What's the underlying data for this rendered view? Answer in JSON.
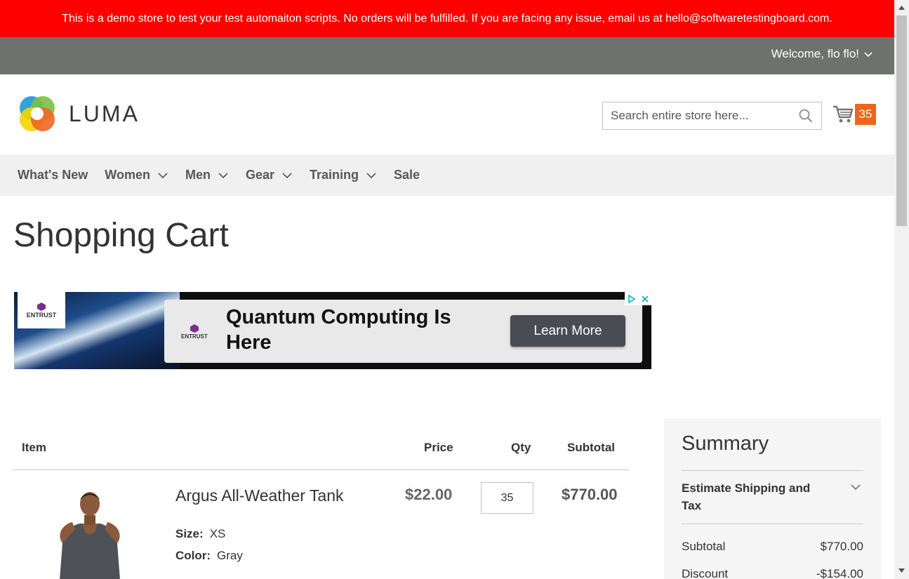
{
  "notice": {
    "text": "This is a demo store to test your test automaiton scripts. No orders will be fulfilled. If you are facing any issue, email us at hello@softwaretestingboard.com.",
    "bg": "#ff0000"
  },
  "header_panel": {
    "welcome": "Welcome, flo flo!"
  },
  "logo": {
    "text": "LUMA"
  },
  "search": {
    "placeholder": "Search entire store here..."
  },
  "minicart": {
    "count": "35",
    "badge_color": "#f1641c"
  },
  "nav": {
    "items": [
      {
        "label": "What's New",
        "has_dropdown": false
      },
      {
        "label": "Women",
        "has_dropdown": true
      },
      {
        "label": "Men",
        "has_dropdown": true
      },
      {
        "label": "Gear",
        "has_dropdown": true
      },
      {
        "label": "Training",
        "has_dropdown": true
      },
      {
        "label": "Sale",
        "has_dropdown": false
      }
    ]
  },
  "page": {
    "title": "Shopping Cart"
  },
  "ad": {
    "brand": "ENTRUST",
    "headline": "Quantum Computing Is Here",
    "cta": "Learn More"
  },
  "cart": {
    "columns": {
      "item": "Item",
      "price": "Price",
      "qty": "Qty",
      "subtotal": "Subtotal"
    },
    "items": [
      {
        "name": "Argus All-Weather Tank",
        "price": "$22.00",
        "qty": "35",
        "subtotal": "$770.00",
        "options": [
          {
            "label": "Size:",
            "value": "XS"
          },
          {
            "label": "Color:",
            "value": "Gray"
          }
        ]
      }
    ]
  },
  "summary": {
    "title": "Summary",
    "estimate": "Estimate Shipping and Tax",
    "rows": [
      {
        "label": "Subtotal",
        "value": "$770.00"
      },
      {
        "label": "Discount",
        "value": "-$154.00"
      }
    ]
  }
}
